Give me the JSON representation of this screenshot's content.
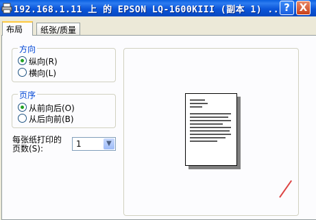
{
  "window": {
    "title": "192.168.1.11 上 的 EPSON LQ-1600KIII (副本 1) ...",
    "help_label": "?",
    "close_label": "X"
  },
  "tabs": [
    {
      "label": "布局",
      "active": true
    },
    {
      "label": "纸张/质量",
      "active": false
    }
  ],
  "orientation": {
    "title": "方向",
    "options": [
      {
        "label": "纵向(R)",
        "selected": true
      },
      {
        "label": "横向(L)",
        "selected": false
      }
    ]
  },
  "page_order": {
    "title": "页序",
    "options": [
      {
        "label": "从前向后(O)",
        "selected": true
      },
      {
        "label": "从后向前(B)",
        "selected": false
      }
    ]
  },
  "pages_per_sheet": {
    "label_line1": "每张纸打印的",
    "label_line2": "页数(S):",
    "value": "1"
  },
  "icons": {
    "title": "printer-icon",
    "select_arrow": "chevron-down-icon"
  },
  "colors": {
    "title_bar": "#0b55d9",
    "group_title": "#0046d5",
    "radio_selected": "#21a121",
    "active_tab_accent": "#ffc83c"
  }
}
